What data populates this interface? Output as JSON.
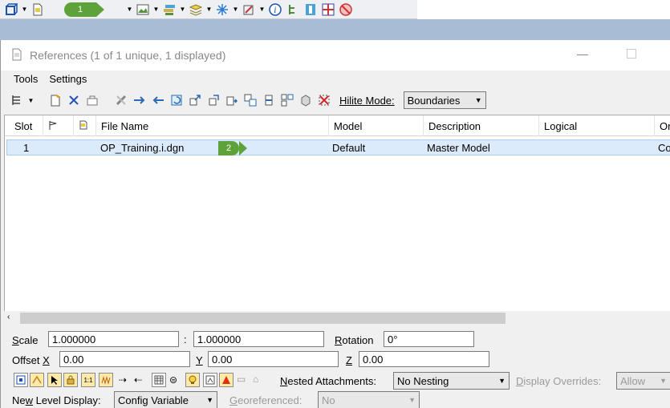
{
  "callouts": {
    "first": "1",
    "second": "2"
  },
  "window": {
    "title": "References (1 of 1 unique, 1 displayed)"
  },
  "menu": {
    "tools": "Tools",
    "settings": "Settings"
  },
  "toolbar": {
    "hilite_label": "Hilite Mode:",
    "hilite_value": "Boundaries"
  },
  "table": {
    "columns": [
      "Slot",
      "",
      "",
      "File Name",
      "Model",
      "Description",
      "Logical",
      "Or"
    ],
    "rows": [
      {
        "slot": "1",
        "file_name": "OP_Training.i.dgn",
        "model": "Default",
        "description": "Master Model",
        "logical": "",
        "orientation": "Co"
      }
    ]
  },
  "settings": {
    "scale_label": "Scale",
    "scale_a": "1.000000",
    "scale_sep": ":",
    "scale_b": "1.000000",
    "rotation_label": "Rotation",
    "rotation_value": "0°",
    "offset_label": "Offset X",
    "offset_x": "0.00",
    "y_label": "Y",
    "offset_y": "0.00",
    "z_label": "Z",
    "offset_z": "0.00",
    "nested_label": "Nested Attachments:",
    "nested_value": "No Nesting",
    "display_overrides_label": "Display Overrides:",
    "display_overrides_value": "Allow",
    "new_level_label": "New Level Display:",
    "new_level_value": "Config Variable",
    "georef_label": "Georeferenced:",
    "georef_value": "No"
  },
  "colors": {
    "accent_green": "#5ea33a",
    "selection": "#dcebfb",
    "band": "#a9bcd6"
  }
}
